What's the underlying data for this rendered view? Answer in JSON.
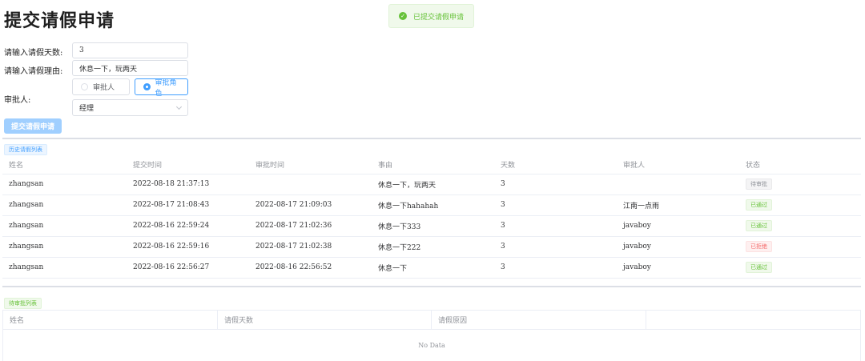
{
  "page_title": "提交请假申请",
  "toast": {
    "text": "已提交请假申请",
    "icon": "check-circle-icon"
  },
  "form": {
    "days_label": "请输入请假天数:",
    "days_value": "3",
    "reason_label": "请输入请假理由:",
    "reason_value": "休息一下，玩两天",
    "approver_label": "审批人:",
    "radio_person": "审批人",
    "radio_role": "审批角色",
    "role_selected": "经理",
    "submit_label": "提交请假申请"
  },
  "history": {
    "tag": "历史请假列表",
    "columns": [
      "姓名",
      "提交时间",
      "审批时间",
      "事由",
      "天数",
      "审批人",
      "状态"
    ],
    "rows": [
      {
        "name": "zhangsan",
        "submit_time": "2022-08-18 21:37:13",
        "approve_time": "",
        "reason": "休息一下，玩两天",
        "days": "3",
        "approver": "",
        "status": "待审批",
        "status_type": "info"
      },
      {
        "name": "zhangsan",
        "submit_time": "2022-08-17 21:08:43",
        "approve_time": "2022-08-17 21:09:03",
        "reason": "休息一下hahahah",
        "days": "3",
        "approver": "江南一点雨",
        "status": "已通过",
        "status_type": "success"
      },
      {
        "name": "zhangsan",
        "submit_time": "2022-08-16 22:59:24",
        "approve_time": "2022-08-17 21:02:36",
        "reason": "休息一下333",
        "days": "3",
        "approver": "javaboy",
        "status": "已通过",
        "status_type": "success"
      },
      {
        "name": "zhangsan",
        "submit_time": "2022-08-16 22:59:16",
        "approve_time": "2022-08-17 21:02:38",
        "reason": "休息一下222",
        "days": "3",
        "approver": "javaboy",
        "status": "已拒绝",
        "status_type": "danger"
      },
      {
        "name": "zhangsan",
        "submit_time": "2022-08-16 22:56:27",
        "approve_time": "2022-08-16 22:56:52",
        "reason": "休息一下",
        "days": "3",
        "approver": "javaboy",
        "status": "已通过",
        "status_type": "success"
      }
    ]
  },
  "pending": {
    "tag": "待审批列表",
    "columns": [
      "姓名",
      "请假天数",
      "请假原因",
      ""
    ],
    "empty_text": "No Data"
  },
  "colors": {
    "primary": "#409eff",
    "success": "#67c23a",
    "danger": "#f56c6c",
    "info": "#909399"
  }
}
